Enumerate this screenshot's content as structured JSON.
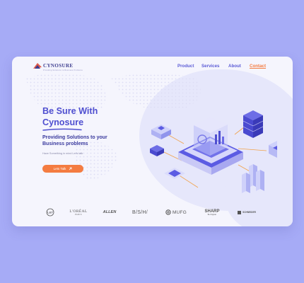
{
  "logo": {
    "name": "CYNOSURE",
    "tagline": "Providing Solutions to Business Problems"
  },
  "nav": {
    "items": [
      "Product",
      "Services",
      "About",
      "Contact"
    ]
  },
  "hero": {
    "line1": "Be Sure With",
    "line2": "Cynosure",
    "subtitle_line1": "Providing Solutions to your",
    "subtitle_line2": "Business problems",
    "tagline": "Have Something in mind Let's talk",
    "cta": "Lets Talk",
    "cta_icon": "arrow-up-right-icon"
  },
  "brands": [
    {
      "name": "L&T",
      "text": "L&T"
    },
    {
      "name": "L'Oréal Paris",
      "text": "L'ORÉAL",
      "sub": "PARIS"
    },
    {
      "name": "Allen",
      "text": "ALLEN"
    },
    {
      "name": "B/S/H/",
      "text": "B/S/H/"
    },
    {
      "name": "MUFG",
      "text": "MUFG"
    },
    {
      "name": "Sharp",
      "text": "SHARP",
      "sub": "Be Original."
    },
    {
      "name": "Schneider",
      "text": "SCHNEIDER"
    }
  ],
  "colors": {
    "background": "#a6abf6",
    "card": "#f5f5fd",
    "primary": "#5b5bd6",
    "heading": "#4f4fd0",
    "accent": "#f47c41"
  }
}
